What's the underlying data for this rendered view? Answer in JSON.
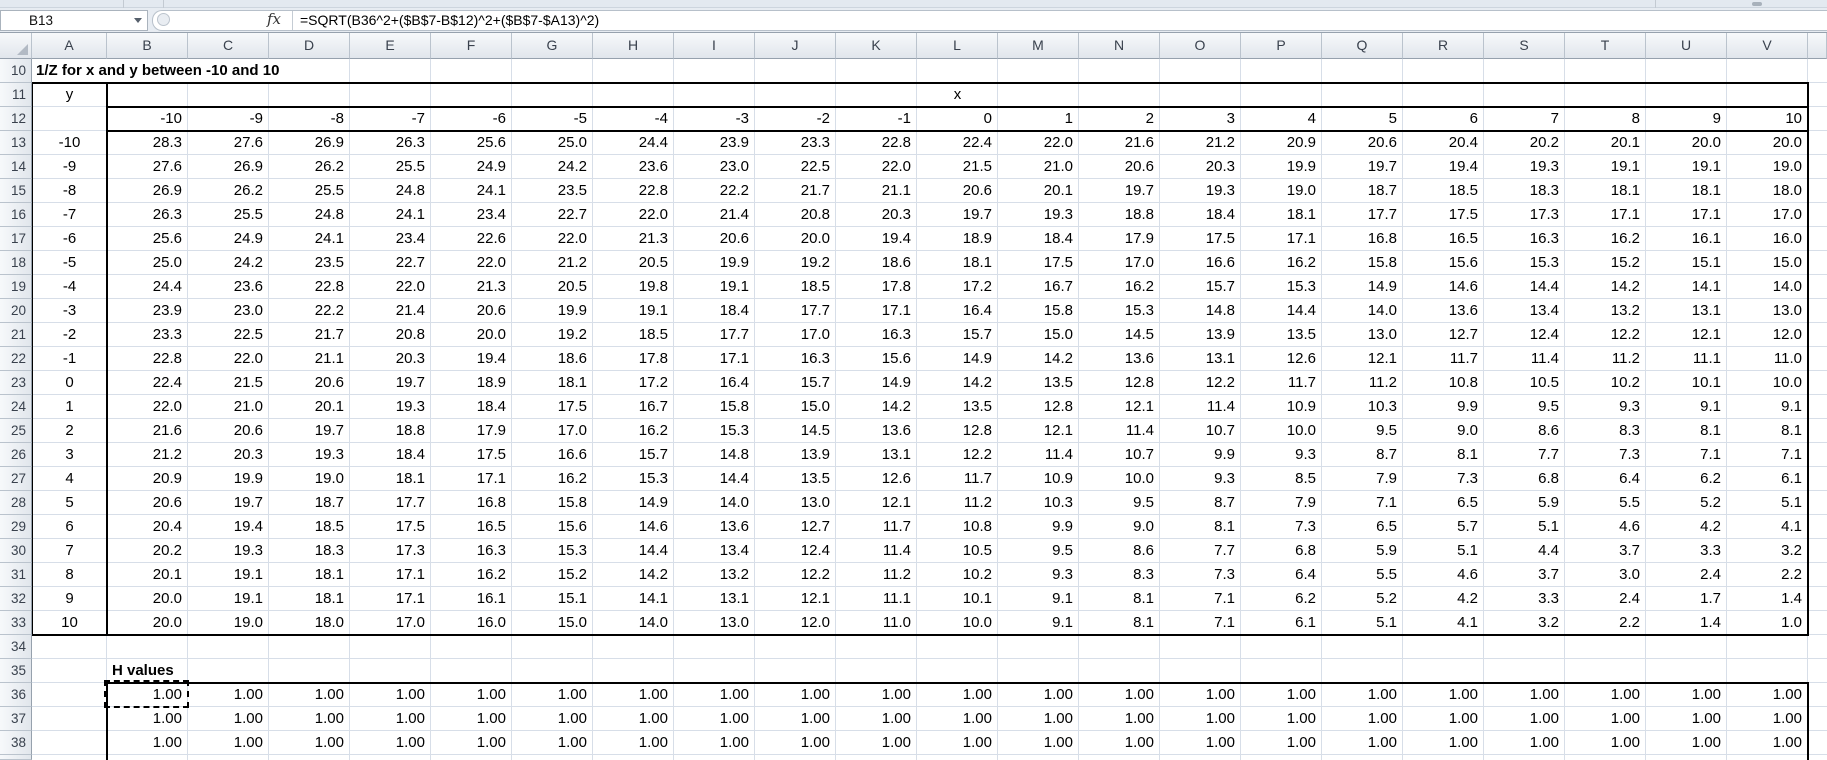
{
  "toolbar": {
    "name_box": "B13",
    "fx_label": "fx",
    "formula": "=SQRT(B36^2+($B$7-B$12)^2+($B$7-$A13)^2)"
  },
  "grid": {
    "column_letters": [
      "A",
      "B",
      "C",
      "D",
      "E",
      "F",
      "G",
      "H",
      "I",
      "J",
      "K",
      "L",
      "M",
      "N",
      "O",
      "P",
      "Q",
      "R",
      "S",
      "T",
      "U",
      "V"
    ],
    "row_numbers": [
      10,
      11,
      12,
      13,
      14,
      15,
      16,
      17,
      18,
      19,
      20,
      21,
      22,
      23,
      24,
      25,
      26,
      27,
      28,
      29,
      30,
      31,
      32,
      33,
      34,
      35,
      36,
      37,
      38
    ]
  },
  "sheet": {
    "title": "1/Z for x and y between -10 and 10",
    "y_label": "y",
    "x_label": "x",
    "x_values": [
      -10,
      -9,
      -8,
      -7,
      -6,
      -5,
      -4,
      -3,
      -2,
      -1,
      0,
      1,
      2,
      3,
      4,
      5,
      6,
      7,
      8,
      9,
      10
    ],
    "y_values": [
      -10,
      -9,
      -8,
      -7,
      -6,
      -5,
      -4,
      -3,
      -2,
      -1,
      0,
      1,
      2,
      3,
      4,
      5,
      6,
      7,
      8,
      9,
      10
    ],
    "values": [
      [
        28.3,
        27.6,
        26.9,
        26.3,
        25.6,
        25.0,
        24.4,
        23.9,
        23.3,
        22.8,
        22.4,
        22.0,
        21.6,
        21.2,
        20.9,
        20.6,
        20.4,
        20.2,
        20.1,
        20.0,
        20.0
      ],
      [
        27.6,
        26.9,
        26.2,
        25.5,
        24.9,
        24.2,
        23.6,
        23.0,
        22.5,
        22.0,
        21.5,
        21.0,
        20.6,
        20.3,
        19.9,
        19.7,
        19.4,
        19.3,
        19.1,
        19.1,
        19.0
      ],
      [
        26.9,
        26.2,
        25.5,
        24.8,
        24.1,
        23.5,
        22.8,
        22.2,
        21.7,
        21.1,
        20.6,
        20.1,
        19.7,
        19.3,
        19.0,
        18.7,
        18.5,
        18.3,
        18.1,
        18.1,
        18.0
      ],
      [
        26.3,
        25.5,
        24.8,
        24.1,
        23.4,
        22.7,
        22.0,
        21.4,
        20.8,
        20.3,
        19.7,
        19.3,
        18.8,
        18.4,
        18.1,
        17.7,
        17.5,
        17.3,
        17.1,
        17.1,
        17.0
      ],
      [
        25.6,
        24.9,
        24.1,
        23.4,
        22.6,
        22.0,
        21.3,
        20.6,
        20.0,
        19.4,
        18.9,
        18.4,
        17.9,
        17.5,
        17.1,
        16.8,
        16.5,
        16.3,
        16.2,
        16.1,
        16.0
      ],
      [
        25.0,
        24.2,
        23.5,
        22.7,
        22.0,
        21.2,
        20.5,
        19.9,
        19.2,
        18.6,
        18.1,
        17.5,
        17.0,
        16.6,
        16.2,
        15.8,
        15.6,
        15.3,
        15.2,
        15.1,
        15.0
      ],
      [
        24.4,
        23.6,
        22.8,
        22.0,
        21.3,
        20.5,
        19.8,
        19.1,
        18.5,
        17.8,
        17.2,
        16.7,
        16.2,
        15.7,
        15.3,
        14.9,
        14.6,
        14.4,
        14.2,
        14.1,
        14.0
      ],
      [
        23.9,
        23.0,
        22.2,
        21.4,
        20.6,
        19.9,
        19.1,
        18.4,
        17.7,
        17.1,
        16.4,
        15.8,
        15.3,
        14.8,
        14.4,
        14.0,
        13.6,
        13.4,
        13.2,
        13.1,
        13.0
      ],
      [
        23.3,
        22.5,
        21.7,
        20.8,
        20.0,
        19.2,
        18.5,
        17.7,
        17.0,
        16.3,
        15.7,
        15.0,
        14.5,
        13.9,
        13.5,
        13.0,
        12.7,
        12.4,
        12.2,
        12.1,
        12.0
      ],
      [
        22.8,
        22.0,
        21.1,
        20.3,
        19.4,
        18.6,
        17.8,
        17.1,
        16.3,
        15.6,
        14.9,
        14.2,
        13.6,
        13.1,
        12.6,
        12.1,
        11.7,
        11.4,
        11.2,
        11.1,
        11.0
      ],
      [
        22.4,
        21.5,
        20.6,
        19.7,
        18.9,
        18.1,
        17.2,
        16.4,
        15.7,
        14.9,
        14.2,
        13.5,
        12.8,
        12.2,
        11.7,
        11.2,
        10.8,
        10.5,
        10.2,
        10.1,
        10.0
      ],
      [
        22.0,
        21.0,
        20.1,
        19.3,
        18.4,
        17.5,
        16.7,
        15.8,
        15.0,
        14.2,
        13.5,
        12.8,
        12.1,
        11.4,
        10.9,
        10.3,
        9.9,
        9.5,
        9.3,
        9.1,
        9.1
      ],
      [
        21.6,
        20.6,
        19.7,
        18.8,
        17.9,
        17.0,
        16.2,
        15.3,
        14.5,
        13.6,
        12.8,
        12.1,
        11.4,
        10.7,
        10.0,
        9.5,
        9.0,
        8.6,
        8.3,
        8.1,
        8.1
      ],
      [
        21.2,
        20.3,
        19.3,
        18.4,
        17.5,
        16.6,
        15.7,
        14.8,
        13.9,
        13.1,
        12.2,
        11.4,
        10.7,
        9.9,
        9.3,
        8.7,
        8.1,
        7.7,
        7.3,
        7.1,
        7.1
      ],
      [
        20.9,
        19.9,
        19.0,
        18.1,
        17.1,
        16.2,
        15.3,
        14.4,
        13.5,
        12.6,
        11.7,
        10.9,
        10.0,
        9.3,
        8.5,
        7.9,
        7.3,
        6.8,
        6.4,
        6.2,
        6.1
      ],
      [
        20.6,
        19.7,
        18.7,
        17.7,
        16.8,
        15.8,
        14.9,
        14.0,
        13.0,
        12.1,
        11.2,
        10.3,
        9.5,
        8.7,
        7.9,
        7.1,
        6.5,
        5.9,
        5.5,
        5.2,
        5.1
      ],
      [
        20.4,
        19.4,
        18.5,
        17.5,
        16.5,
        15.6,
        14.6,
        13.6,
        12.7,
        11.7,
        10.8,
        9.9,
        9.0,
        8.1,
        7.3,
        6.5,
        5.7,
        5.1,
        4.6,
        4.2,
        4.1
      ],
      [
        20.2,
        19.3,
        18.3,
        17.3,
        16.3,
        15.3,
        14.4,
        13.4,
        12.4,
        11.4,
        10.5,
        9.5,
        8.6,
        7.7,
        6.8,
        5.9,
        5.1,
        4.4,
        3.7,
        3.3,
        3.2
      ],
      [
        20.1,
        19.1,
        18.1,
        17.1,
        16.2,
        15.2,
        14.2,
        13.2,
        12.2,
        11.2,
        10.2,
        9.3,
        8.3,
        7.3,
        6.4,
        5.5,
        4.6,
        3.7,
        3.0,
        2.4,
        2.2
      ],
      [
        20.0,
        19.1,
        18.1,
        17.1,
        16.1,
        15.1,
        14.1,
        13.1,
        12.1,
        11.1,
        10.1,
        9.1,
        8.1,
        7.1,
        6.2,
        5.2,
        4.2,
        3.3,
        2.4,
        1.7,
        1.4
      ],
      [
        20.0,
        19.0,
        18.0,
        17.0,
        16.0,
        15.0,
        14.0,
        13.0,
        12.0,
        11.0,
        10.0,
        9.1,
        8.1,
        7.1,
        6.1,
        5.1,
        4.1,
        3.2,
        2.2,
        1.4,
        1.0
      ]
    ],
    "h_label": "H values",
    "h_value": "1.00",
    "h_row_numbers": [
      36,
      37,
      38
    ]
  },
  "colors": {
    "grid_line": "#d7dee8",
    "table_border": "#000000",
    "header_text": "#39414d",
    "cell_text": "#000000",
    "marquee": "#000000"
  }
}
